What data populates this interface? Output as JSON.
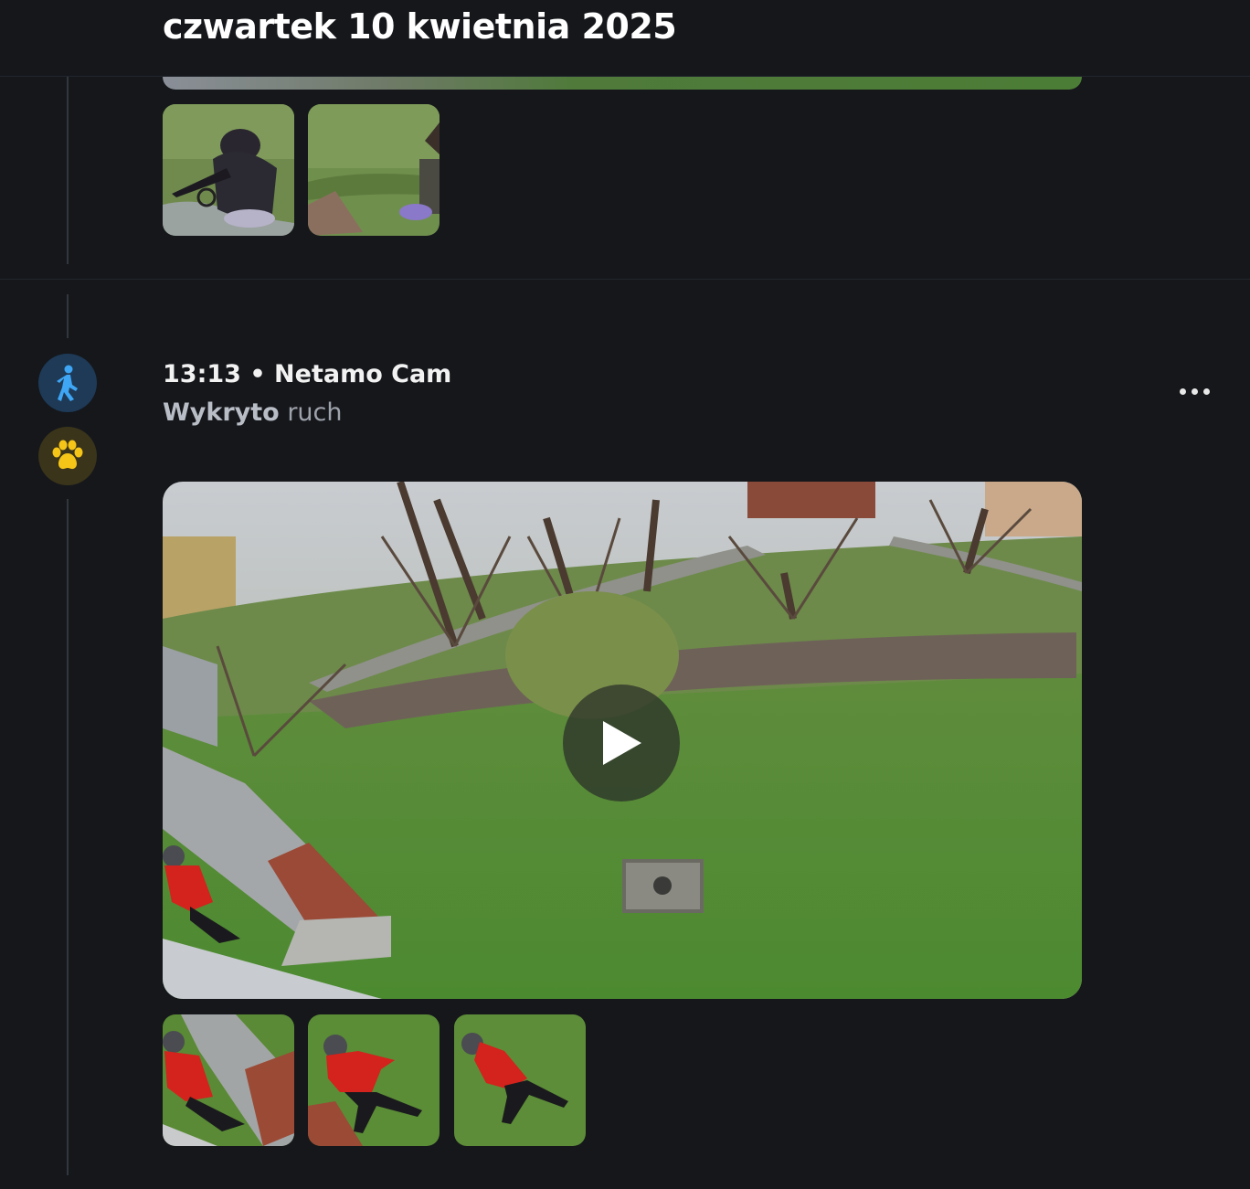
{
  "header": {
    "date_title": "czwartek 10 kwietnia 2025"
  },
  "event": {
    "time": "13:13",
    "separator": "•",
    "camera": "Netamo Cam",
    "detected_strong": "Wykryto",
    "detected_rest": "ruch",
    "type_icons": [
      "walking-person-icon",
      "paw-icon"
    ],
    "icon_colors": {
      "walk": "#3ea6f5",
      "paw": "#f5c518"
    }
  },
  "previous_event": {
    "thumbnails": [
      "person-on-bike",
      "bike-on-grass"
    ]
  },
  "current_event": {
    "thumbnails": [
      "person-red-jacket-1",
      "person-red-jacket-2",
      "person-red-jacket-3"
    ]
  }
}
